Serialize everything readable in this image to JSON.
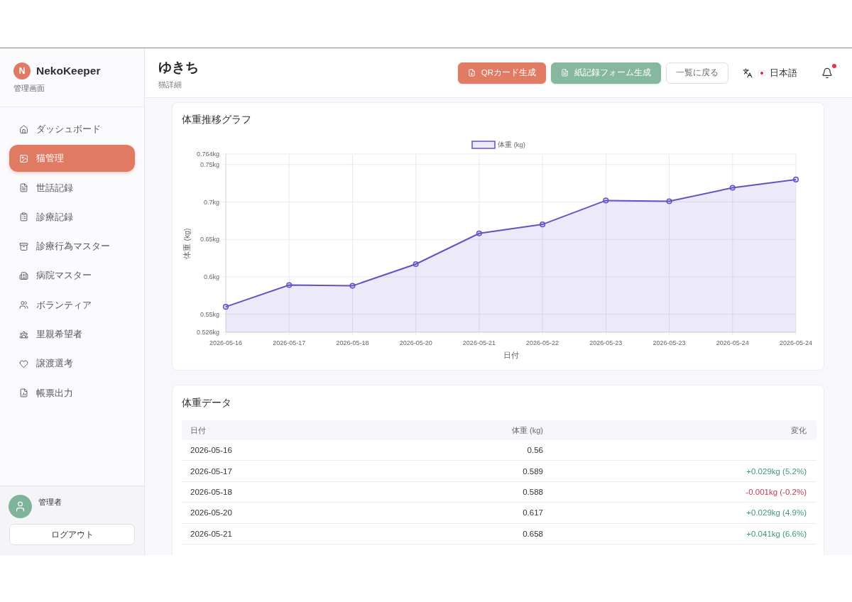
{
  "sidebar": {
    "logo": {
      "initial": "N",
      "name": "NekoKeeper",
      "subtitle": "管理画面"
    },
    "items": [
      {
        "label": "ダッシュボード",
        "selected": false
      },
      {
        "label": "猫管理",
        "selected": true
      },
      {
        "label": "世話記録",
        "selected": false
      },
      {
        "label": "診療記録",
        "selected": false
      },
      {
        "label": "診療行為マスター",
        "selected": false
      },
      {
        "label": "病院マスター",
        "selected": false
      },
      {
        "label": "ボランティア",
        "selected": false
      },
      {
        "label": "里親希望者",
        "selected": false
      },
      {
        "label": "譲渡選考",
        "selected": false
      },
      {
        "label": "帳票出力",
        "selected": false
      }
    ],
    "user": {
      "name": "管理者",
      "logout": "ログアウト"
    }
  },
  "header": {
    "title": "ゆきち",
    "subtitle": "猫詳細",
    "buttons": [
      {
        "label": "QRカード生成",
        "kind": "primary"
      },
      {
        "label": "紙記録フォーム生成",
        "kind": "secondary"
      },
      {
        "label": "一覧に戻る",
        "kind": "outline"
      }
    ],
    "language": "日本語",
    "notifications": {
      "unread": true
    }
  },
  "chart_card": {
    "chart_data": {
      "type": "area",
      "title": "体重推移グラフ",
      "xlabel": "日付",
      "ylabel": "体重 (kg)",
      "grid": true,
      "categories": [
        "2026-05-16",
        "2026-05-17",
        "2026-05-18",
        "2026-05-20",
        "2026-05-21",
        "2026-05-22",
        "2026-05-23",
        "2026-05-23",
        "2026-05-24",
        "2026-05-24"
      ],
      "series": [
        {
          "name": "体重 (kg)",
          "color": "#6253c4",
          "values": [
            0.56,
            0.589,
            0.588,
            0.617,
            0.658,
            0.67,
            0.702,
            0.701,
            0.719,
            0.73
          ]
        }
      ],
      "ylim": [
        0.526,
        0.764
      ],
      "yticks": [
        {
          "value": 0.526,
          "label": "0.526kg"
        },
        {
          "value": 0.55,
          "label": "0.55kg"
        },
        {
          "value": 0.6,
          "label": "0.6kg"
        },
        {
          "value": 0.65,
          "label": "0.65kg"
        },
        {
          "value": 0.7,
          "label": "0.7kg"
        },
        {
          "value": 0.75,
          "label": "0.75kg"
        },
        {
          "value": 0.764,
          "label": "0.764kg"
        }
      ]
    }
  },
  "table_card": {
    "title": "体重データ",
    "columns": [
      "日付",
      "体重 (kg)",
      "変化"
    ],
    "rows": [
      {
        "date": "2026-05-16",
        "weight": "0.56"
      },
      {
        "date": "2026-05-17",
        "weight": "0.589",
        "change": "+0.029kg (5.2%)",
        "color": "#3f9a73"
      },
      {
        "date": "2026-05-18",
        "weight": "0.588",
        "change": "-0.001kg (-0.2%)",
        "color": "#c23a55"
      },
      {
        "date": "2026-05-20",
        "weight": "0.617",
        "change": "+0.029kg (4.9%)",
        "color": "#3f9a73"
      },
      {
        "date": "2026-05-21",
        "weight": "0.658",
        "change": "+0.041kg (6.6%)",
        "color": "#3f9a73"
      }
    ]
  }
}
